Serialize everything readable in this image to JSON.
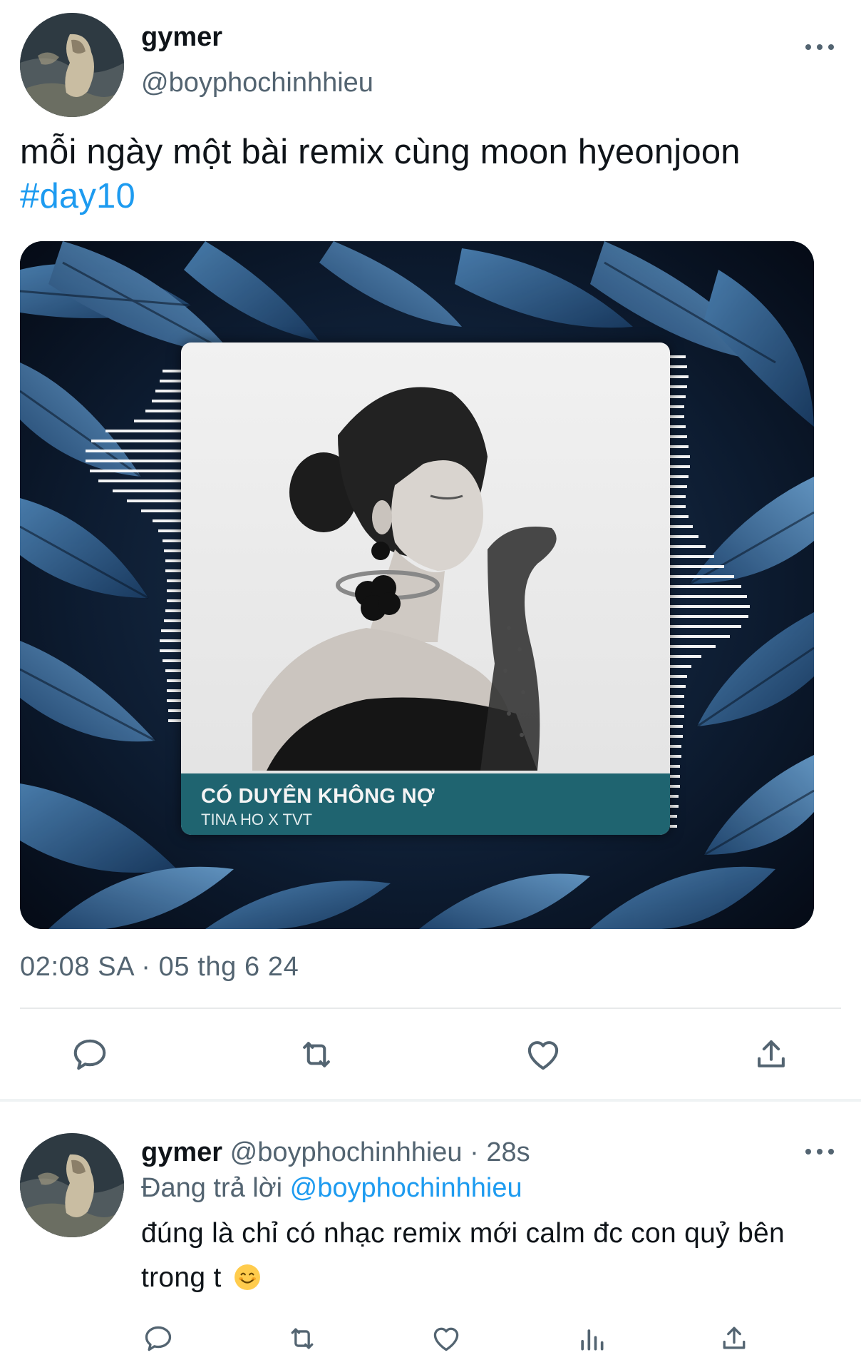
{
  "tweet": {
    "display_name": "gymer",
    "handle": "@boyphochinhhieu",
    "text": "mỗi ngày một bài remix cùng moon hyeonjoon",
    "hashtag": "#day10",
    "media": {
      "song_title": "CÓ DUYÊN KHÔNG NỢ",
      "song_artist": "TINA HO X TVT"
    },
    "timestamp": "02:08 SA · 05 thg 6 24"
  },
  "reply": {
    "display_name": "gymer",
    "handle_time": "@boyphochinhhieu · 28s",
    "replying_prefix": "Đang trả lời",
    "replying_to": "@boyphochinhhieu",
    "text": "đúng là chỉ có nhạc remix mới calm đc con quỷ bên trong t"
  },
  "icons": {
    "more": "more-horizontal-icon",
    "reply": "reply-icon",
    "retweet": "retweet-icon",
    "like": "heart-icon",
    "share": "share-icon",
    "views": "views-icon",
    "emoji": "smiling-face-emoji"
  },
  "colors": {
    "link": "#1d9bf0",
    "secondary_text": "#536471",
    "action_icon": "#536471",
    "cover_band": "#1f6470"
  }
}
